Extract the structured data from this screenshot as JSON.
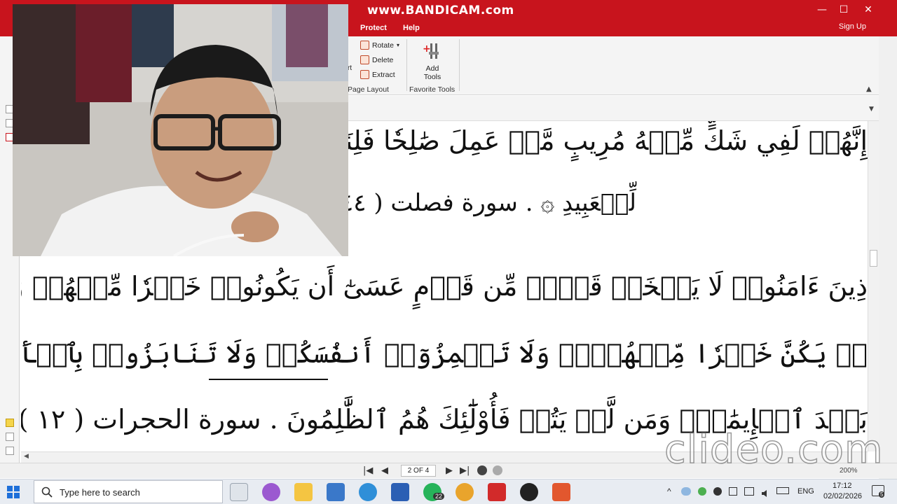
{
  "window": {
    "watermark": "www.BANDICAM.com",
    "minimize_icon": "—",
    "maximize_icon": "☐",
    "close_icon": "✕"
  },
  "menu": {
    "items": [
      "Protect",
      "Help"
    ],
    "signup": "Sign Up"
  },
  "ribbon": {
    "rotate": "Rotate",
    "delete": "Delete",
    "extract": "Extract",
    "page_layout_group": "Page Layout",
    "add_tools_line1": "Add",
    "add_tools_line2": "Tools",
    "favorite_tools_group": "Favorite Tools",
    "partial_left_top": "rt",
    "accent": "#c8141d"
  },
  "document": {
    "lines": [
      "إِنَّهُمۡ لَفِي شَكٍّ مِّنۡهُ مُرِيبٍ مَّنۡ عَمِلَ صَٰلِحٗا فَلِنَفۡسِهِۦۖ وَمَنۡ ا",
      "لِّلۡعَبِيدِ ۞ . سورة فصلت ( ٤٤ )",
      "ذِينَ ءَامَنُوا۟ لَا يَسۡخَرۡ قَوۡمٞ مِّن قَوۡمٍ عَسَىٰٓ أَن يَكُونُوا۟ خَيۡرٗا مِّنۡهُمۡ وَلَا نِسَآءٞ مِّن نِّسَآءٍ",
      "نۡ يَكُنَّ خَيۡرٗا مِّنۡهُنَّۖ وَلَا تَلۡمِزُوٓا۟ أَنفُسَكُمۡ وَلَا تَنَابَزُوا۟ بِٱلۡأَلۡقَٰبِۖ بِئۡسَ ٱلِٱسۡمُ",
      "بَعۡدَ ٱلۡإِيمَٰنِۚ وَمَن لَّمۡ يَتُبۡ فَأُوْلَٰٓئِكَ هُمُ ٱلظَّٰلِمُونَ . سورة الحجرات ( ١٢ )"
    ]
  },
  "pagination": {
    "page_indicator": "2 OF 4",
    "first_icon": "|◀",
    "prev_icon": "◀",
    "next_icon": "▶",
    "last_icon": "▶|",
    "zoom": "200%"
  },
  "clideo_watermark": "clideo.com",
  "taskbar": {
    "search_placeholder": "Type here to search",
    "whatsapp_badge": "22",
    "language": "ENG",
    "time": "17:12",
    "date": "02/02/2026",
    "notification_count": "5"
  }
}
